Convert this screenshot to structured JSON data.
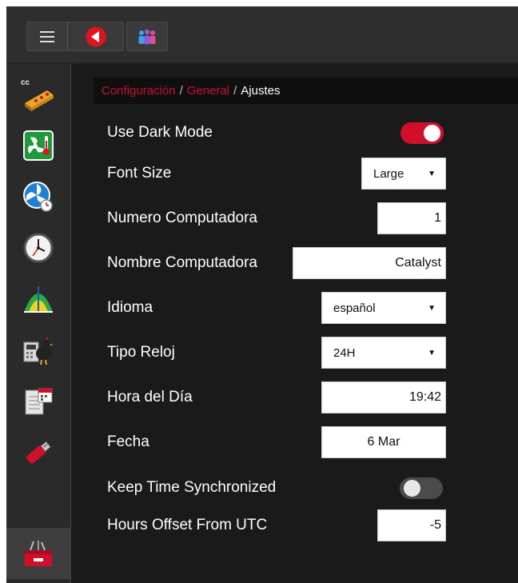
{
  "breadcrumb": {
    "items": [
      "Configuración",
      "General"
    ],
    "separator": "/",
    "current": "Ajustes"
  },
  "settings": {
    "dark_mode": {
      "label": "Use Dark Mode",
      "enabled": true
    },
    "font_size": {
      "label": "Font Size",
      "value": "Large"
    },
    "computer_number": {
      "label": "Numero Computadora",
      "value": "1"
    },
    "computer_name": {
      "label": "Nombre Computadora",
      "value": "Catalyst"
    },
    "language": {
      "label": "Idioma",
      "value": "español"
    },
    "clock_type": {
      "label": "Tipo Reloj",
      "value": "24H"
    },
    "time_of_day": {
      "label": "Hora del Día",
      "value": "19:42"
    },
    "date": {
      "label": "Fecha",
      "value": "6 Mar"
    },
    "keep_synced": {
      "label": "Keep Time Synchronized",
      "enabled": false
    },
    "utc_offset": {
      "label": "Hours Offset From UTC",
      "value": "-5"
    }
  },
  "sidebar": {
    "items": [
      {
        "icon": "cc-heater-icon",
        "label": "cc"
      },
      {
        "icon": "fan-thermometer-icon"
      },
      {
        "icon": "ventilation-timer-icon"
      },
      {
        "icon": "clock-icon"
      },
      {
        "icon": "growth-curve-icon"
      },
      {
        "icon": "bird-scale-icon"
      },
      {
        "icon": "calendar-report-icon"
      },
      {
        "icon": "usb-drive-icon"
      },
      {
        "icon": "toolbox-icon"
      }
    ]
  },
  "colors": {
    "accent": "#c8102e",
    "background": "#1a1a1a",
    "panel": "#2e2e2e"
  }
}
